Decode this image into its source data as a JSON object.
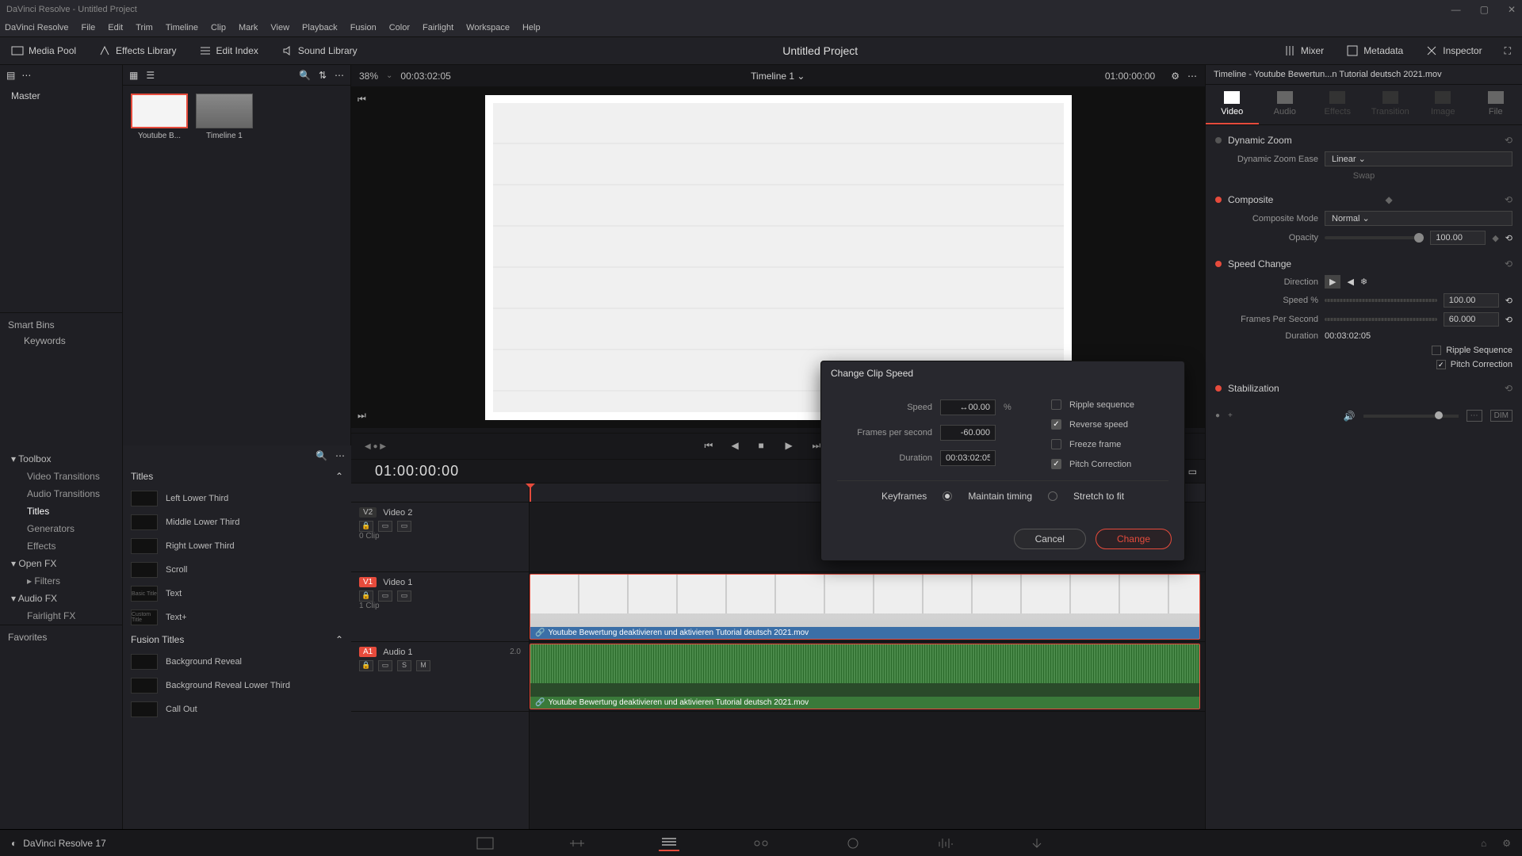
{
  "window": {
    "title": "DaVinci Resolve - Untitled Project"
  },
  "menu": [
    "DaVinci Resolve",
    "File",
    "Edit",
    "Trim",
    "Timeline",
    "Clip",
    "Mark",
    "View",
    "Playback",
    "Fusion",
    "Color",
    "Fairlight",
    "Workspace",
    "Help"
  ],
  "toolbar": {
    "media_pool": "Media Pool",
    "effects_library": "Effects Library",
    "edit_index": "Edit Index",
    "sound_library": "Sound Library",
    "project": "Untitled Project",
    "mixer": "Mixer",
    "metadata": "Metadata",
    "inspector": "Inspector"
  },
  "viewer_bar": {
    "zoom": "38%",
    "tc_left": "00:03:02:05",
    "timeline_name": "Timeline 1",
    "tc_right": "01:00:00:00"
  },
  "media": {
    "master": "Master",
    "smart_bins": "Smart Bins",
    "keywords": "Keywords",
    "clips": [
      {
        "name": "Youtube B..."
      },
      {
        "name": "Timeline 1"
      }
    ]
  },
  "effects_tree": {
    "toolbox": "Toolbox",
    "video_transitions": "Video Transitions",
    "audio_transitions": "Audio Transitions",
    "titles": "Titles",
    "generators": "Generators",
    "effects": "Effects",
    "open_fx": "Open FX",
    "filters": "Filters",
    "audio_fx": "Audio FX",
    "fairlight_fx": "Fairlight FX",
    "favorites": "Favorites"
  },
  "titles_hdr": "Titles",
  "fusion_titles_hdr": "Fusion Titles",
  "title_items": [
    "Left Lower Third",
    "Middle Lower Third",
    "Right Lower Third",
    "Scroll",
    "Text",
    "Text+"
  ],
  "fusion_title_items": [
    "Background Reveal",
    "Background Reveal Lower Third",
    "Call Out"
  ],
  "transport_tc": "01:00:00:00",
  "tracks": {
    "v2": {
      "badge": "V2",
      "name": "Video 2",
      "clips": "0 Clip"
    },
    "v1": {
      "badge": "V1",
      "name": "Video 1",
      "clips": "1 Clip"
    },
    "a1": {
      "badge": "A1",
      "name": "Audio 1",
      "ch": "2.0"
    }
  },
  "clip_name": "Youtube Bewertung deaktivieren und aktivieren Tutorial deutsch 2021.mov",
  "dialog": {
    "title": "Change Clip Speed",
    "speed_label": "Speed",
    "speed_value": "↔00.00",
    "speed_unit": "%",
    "fps_label": "Frames per second",
    "fps_value": "-60.000",
    "duration_label": "Duration",
    "duration_value": "00:03:02:05",
    "ripple": "Ripple sequence",
    "reverse": "Reverse speed",
    "freeze": "Freeze frame",
    "pitch": "Pitch Correction",
    "keyframes": "Keyframes",
    "maintain": "Maintain timing",
    "stretch": "Stretch to fit",
    "cancel": "Cancel",
    "change": "Change"
  },
  "inspector": {
    "title": "Timeline - Youtube Bewertun...n Tutorial deutsch 2021.mov",
    "tabs": [
      "Video",
      "Audio",
      "Effects",
      "Transition",
      "Image",
      "File"
    ],
    "dynamic_zoom": "Dynamic Zoom",
    "dz_ease_label": "Dynamic Zoom Ease",
    "dz_ease_value": "Linear",
    "swap": "Swap",
    "composite": "Composite",
    "composite_mode_label": "Composite Mode",
    "composite_mode_value": "Normal",
    "opacity_label": "Opacity",
    "opacity_value": "100.00",
    "speed_change": "Speed Change",
    "direction_label": "Direction",
    "speed_pct_label": "Speed %",
    "speed_pct_value": "100.00",
    "fps_label": "Frames Per Second",
    "fps_value": "60.000",
    "duration_label": "Duration",
    "duration_value": "00:03:02:05",
    "ripple_seq": "Ripple Sequence",
    "pitch_corr": "Pitch Correction",
    "stabilization": "Stabilization",
    "dim": "DIM"
  },
  "footer": {
    "version": "DaVinci Resolve 17"
  }
}
